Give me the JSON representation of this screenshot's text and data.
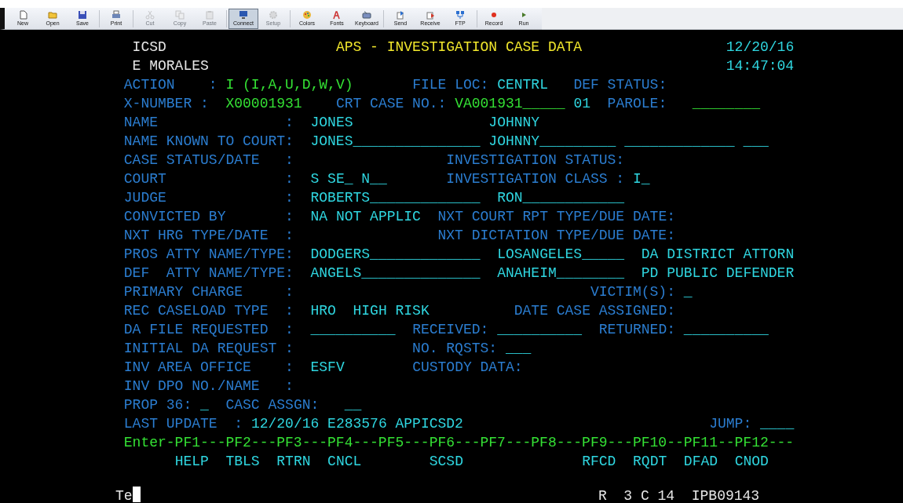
{
  "toolbar": {
    "buttons": [
      {
        "label": "New",
        "disabled": false,
        "pressed": false
      },
      {
        "label": "Open",
        "disabled": false,
        "pressed": false
      },
      {
        "label": "Save",
        "disabled": false,
        "pressed": false
      },
      {
        "label": "Print",
        "disabled": false,
        "pressed": false
      },
      {
        "label": "Cut",
        "disabled": true,
        "pressed": false
      },
      {
        "label": "Copy",
        "disabled": true,
        "pressed": false
      },
      {
        "label": "Paste",
        "disabled": true,
        "pressed": false
      },
      {
        "label": "Connect",
        "disabled": false,
        "pressed": true
      },
      {
        "label": "Setup",
        "disabled": true,
        "pressed": false
      },
      {
        "label": "Colors",
        "disabled": false,
        "pressed": false
      },
      {
        "label": "Fonts",
        "disabled": false,
        "pressed": false
      },
      {
        "label": "Keyboard",
        "disabled": false,
        "pressed": false
      },
      {
        "label": "Send",
        "disabled": false,
        "pressed": false
      },
      {
        "label": "Receive",
        "disabled": false,
        "pressed": false
      },
      {
        "label": "FTP",
        "disabled": false,
        "pressed": false
      },
      {
        "label": "Record",
        "disabled": false,
        "pressed": false
      },
      {
        "label": "Run",
        "disabled": false,
        "pressed": false
      }
    ]
  },
  "screen": {
    "lines": [
      [
        {
          "text": "ICSD",
          "kind": "header"
        },
        {
          "text": "APS - INVESTIGATION CASE DATA",
          "kind": "title"
        },
        {
          "text": "12/20/16",
          "kind": "value"
        }
      ],
      [
        {
          "text": "E MORALES",
          "kind": "header"
        },
        {
          "text": "14:47:04",
          "kind": "value"
        }
      ],
      [
        {
          "text": "ACTION",
          "kind": "label"
        },
        {
          "text": ":",
          "kind": "label"
        },
        {
          "text": "I (I,A,U,D,W,V)",
          "kind": "input"
        },
        {
          "text": "FILE LOC:",
          "kind": "label"
        },
        {
          "text": "CENTRL",
          "kind": "value"
        },
        {
          "text": "DEF STATUS:",
          "kind": "label"
        }
      ],
      [
        {
          "text": "X-NUMBER :",
          "kind": "label"
        },
        {
          "text": "X00001931",
          "kind": "input"
        },
        {
          "text": "CRT CASE NO.:",
          "kind": "label"
        },
        {
          "text": "VA001931_____",
          "kind": "input"
        },
        {
          "text": "01",
          "kind": "value"
        },
        {
          "text": "PAROLE:",
          "kind": "label"
        },
        {
          "text": "________",
          "kind": "input"
        }
      ],
      [
        {
          "text": "NAME",
          "kind": "label"
        },
        {
          "text": ":",
          "kind": "label"
        },
        {
          "text": "JONES",
          "kind": "value"
        },
        {
          "text": "JOHNNY",
          "kind": "value"
        }
      ],
      [
        {
          "text": "NAME KNOWN TO COURT:",
          "kind": "label"
        },
        {
          "text": "JONES_______________",
          "kind": "value"
        },
        {
          "text": "JOHNNY_________",
          "kind": "value"
        },
        {
          "text": "_____________",
          "kind": "value"
        },
        {
          "text": "___",
          "kind": "value"
        }
      ],
      [
        {
          "text": "CASE STATUS/DATE",
          "kind": "label"
        },
        {
          "text": ":",
          "kind": "label"
        },
        {
          "text": "INVESTIGATION STATUS:",
          "kind": "label"
        }
      ],
      [
        {
          "text": "COURT",
          "kind": "label"
        },
        {
          "text": ":",
          "kind": "label"
        },
        {
          "text": "S SE_ N__",
          "kind": "value"
        },
        {
          "text": "INVESTIGATION CLASS :",
          "kind": "label"
        },
        {
          "text": "I_",
          "kind": "value"
        }
      ],
      [
        {
          "text": "JUDGE",
          "kind": "label"
        },
        {
          "text": ":",
          "kind": "label"
        },
        {
          "text": "ROBERTS_____________",
          "kind": "value"
        },
        {
          "text": "RON____________",
          "kind": "value"
        }
      ],
      [
        {
          "text": "CONVICTED BY",
          "kind": "label"
        },
        {
          "text": ":",
          "kind": "label"
        },
        {
          "text": "NA NOT APPLIC",
          "kind": "value"
        },
        {
          "text": "NXT COURT RPT TYPE/DUE DATE:",
          "kind": "label"
        }
      ],
      [
        {
          "text": "NXT HRG TYPE/DATE",
          "kind": "label"
        },
        {
          "text": ":",
          "kind": "label"
        },
        {
          "text": "NXT DICTATION TYPE/DUE DATE:",
          "kind": "label"
        }
      ],
      [
        {
          "text": "PROS ATTY NAME/TYPE:",
          "kind": "label"
        },
        {
          "text": "DODGERS_____________",
          "kind": "value"
        },
        {
          "text": "LOSANGELES_____",
          "kind": "value"
        },
        {
          "text": "DA DISTRICT ATTORN",
          "kind": "value"
        }
      ],
      [
        {
          "text": "DEF  ATTY NAME/TYPE:",
          "kind": "label"
        },
        {
          "text": "ANGELS______________",
          "kind": "value"
        },
        {
          "text": "ANAHEIM________",
          "kind": "value"
        },
        {
          "text": "PD PUBLIC DEFENDER",
          "kind": "value"
        }
      ],
      [
        {
          "text": "PRIMARY CHARGE",
          "kind": "label"
        },
        {
          "text": ":",
          "kind": "label"
        },
        {
          "text": "VICTIM(S):",
          "kind": "label"
        },
        {
          "text": "_",
          "kind": "value"
        }
      ],
      [
        {
          "text": "REC CASELOAD TYPE",
          "kind": "label"
        },
        {
          "text": ":",
          "kind": "label"
        },
        {
          "text": "HRO",
          "kind": "value"
        },
        {
          "text": "HIGH RISK",
          "kind": "value"
        },
        {
          "text": "DATE CASE ASSIGNED:",
          "kind": "label"
        }
      ],
      [
        {
          "text": "DA FILE REQUESTED",
          "kind": "label"
        },
        {
          "text": ":",
          "kind": "label"
        },
        {
          "text": "__________",
          "kind": "value"
        },
        {
          "text": "RECEIVED:",
          "kind": "label"
        },
        {
          "text": "__________",
          "kind": "value"
        },
        {
          "text": "RETURNED:",
          "kind": "label"
        },
        {
          "text": "__________",
          "kind": "value"
        }
      ],
      [
        {
          "text": "INITIAL DA REQUEST :",
          "kind": "label"
        },
        {
          "text": "NO. RQSTS:",
          "kind": "label"
        },
        {
          "text": "___",
          "kind": "value"
        }
      ],
      [
        {
          "text": "INV AREA OFFICE",
          "kind": "label"
        },
        {
          "text": ":",
          "kind": "label"
        },
        {
          "text": "ESFV",
          "kind": "value"
        },
        {
          "text": "CUSTODY DATA:",
          "kind": "label"
        }
      ],
      [
        {
          "text": "INV DPO NO./NAME",
          "kind": "label"
        },
        {
          "text": ":",
          "kind": "label"
        }
      ],
      [
        {
          "text": "PROP 36:",
          "kind": "label"
        },
        {
          "text": "_",
          "kind": "value"
        },
        {
          "text": "CASC ASSGN:",
          "kind": "label"
        },
        {
          "text": "__",
          "kind": "value"
        }
      ],
      [
        {
          "text": "LAST UPDATE",
          "kind": "label"
        },
        {
          "text": ":",
          "kind": "label"
        },
        {
          "text": "12/20/16 E283576 APPICSD2",
          "kind": "value"
        },
        {
          "text": "JUMP:",
          "kind": "label"
        },
        {
          "text": "____",
          "kind": "value"
        }
      ],
      [
        {
          "text": "Enter-PF1---PF2---PF3---PF4---PF5---PF6---PF7---PF8---PF9---PF10--PF11--PF12---",
          "kind": "pf"
        }
      ],
      [
        {
          "text": "HELP",
          "kind": "key"
        },
        {
          "text": "TBLS",
          "kind": "key"
        },
        {
          "text": "RTRN",
          "kind": "key"
        },
        {
          "text": "CNCL",
          "kind": "key"
        },
        {
          "text": "SCSD",
          "kind": "key"
        },
        {
          "text": "RFCD",
          "kind": "key"
        },
        {
          "text": "RQDT",
          "kind": "key"
        },
        {
          "text": "DFAD",
          "kind": "key"
        },
        {
          "text": "CNOD",
          "kind": "key"
        }
      ]
    ]
  },
  "status_line": {
    "input": "Te",
    "mode": "R",
    "cursor_position": "3 C 14",
    "terminal_id": "IPB09143"
  }
}
